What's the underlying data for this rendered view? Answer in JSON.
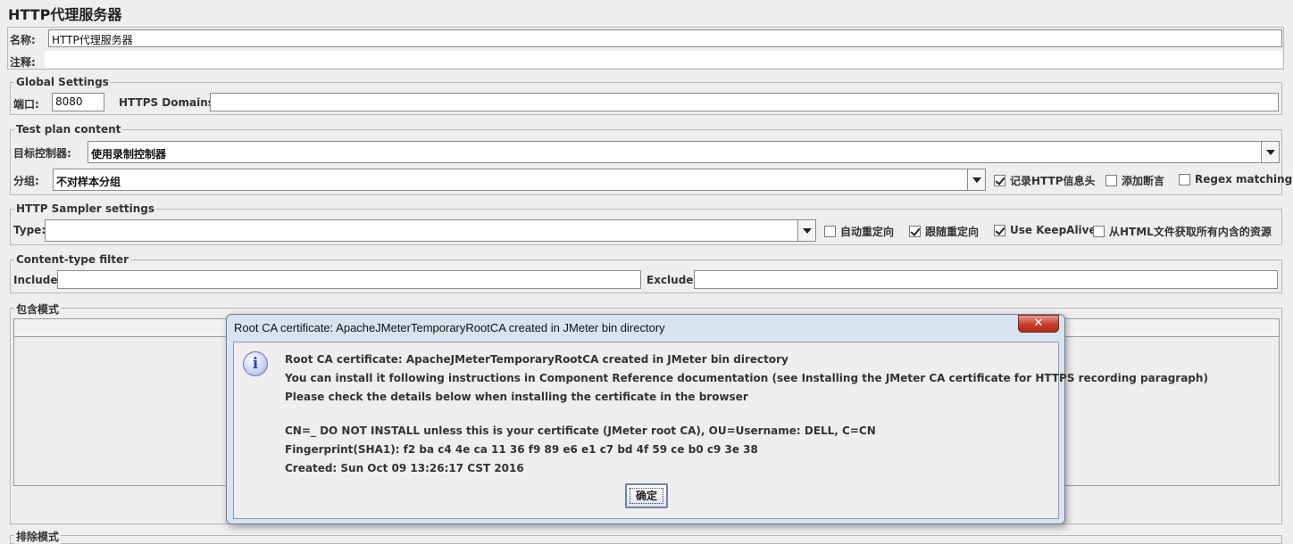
{
  "page_title": "HTTP代理服务器",
  "name_label": "名称:",
  "name_value": "HTTP代理服务器",
  "comment_label": "注释:",
  "global_settings": {
    "legend": "Global Settings",
    "port_label": "端口:",
    "port_value": "8080",
    "https_label": "HTTPS Domains :",
    "https_value": ""
  },
  "test_plan": {
    "legend": "Test plan content",
    "target_label": "目标控制器:",
    "target_value": "使用录制控制器",
    "group_label": "分组:",
    "group_value": "不对样本分组",
    "record_http_label": "记录HTTP信息头",
    "record_http_checked": true,
    "add_assert_label": "添加断言",
    "add_assert_checked": false,
    "regex_label": "Regex matching",
    "regex_checked": false
  },
  "sampler": {
    "legend": "HTTP Sampler settings",
    "type_label": "Type:",
    "type_value": "",
    "auto_redirect_label": "自动重定向",
    "auto_redirect_checked": false,
    "follow_redirect_label": "跟随重定向",
    "follow_redirect_checked": true,
    "keepalive_label": "Use KeepAlive",
    "keepalive_checked": true,
    "retrieve_label": "从HTML文件获取所有内含的资源",
    "retrieve_checked": false
  },
  "content_filter": {
    "legend": "Content-type filter",
    "include_label": "Include:",
    "include_value": "",
    "exclude_label": "Exclude:",
    "exclude_value": ""
  },
  "include_patterns_legend": "包含模式",
  "exclude_patterns_legend": "排除模式",
  "dialog": {
    "title": "Root CA certificate: ApacheJMeterTemporaryRootCA created in JMeter bin directory",
    "close_glyph": "✕",
    "icon": "info-icon",
    "line1": "Root CA certificate: ApacheJMeterTemporaryRootCA created in JMeter bin directory",
    "line2": "You can install it following instructions in Component Reference documentation (see Installing the JMeter CA certificate for HTTPS recording paragraph)",
    "line3": "Please check the details below when installing the certificate in the browser",
    "line4": "CN=_ DO NOT INSTALL unless this is your certificate (JMeter root CA), OU=Username: DELL, C=CN",
    "line5": "Fingerprint(SHA1): f2 ba c4 4e ca 11 36 f9 89 e6 e1 c7 bd 4f 59 ce b0 c9 3e 38",
    "line6": "Created: Sun Oct 09 13:26:17 CST 2016",
    "ok_label": "确定"
  }
}
